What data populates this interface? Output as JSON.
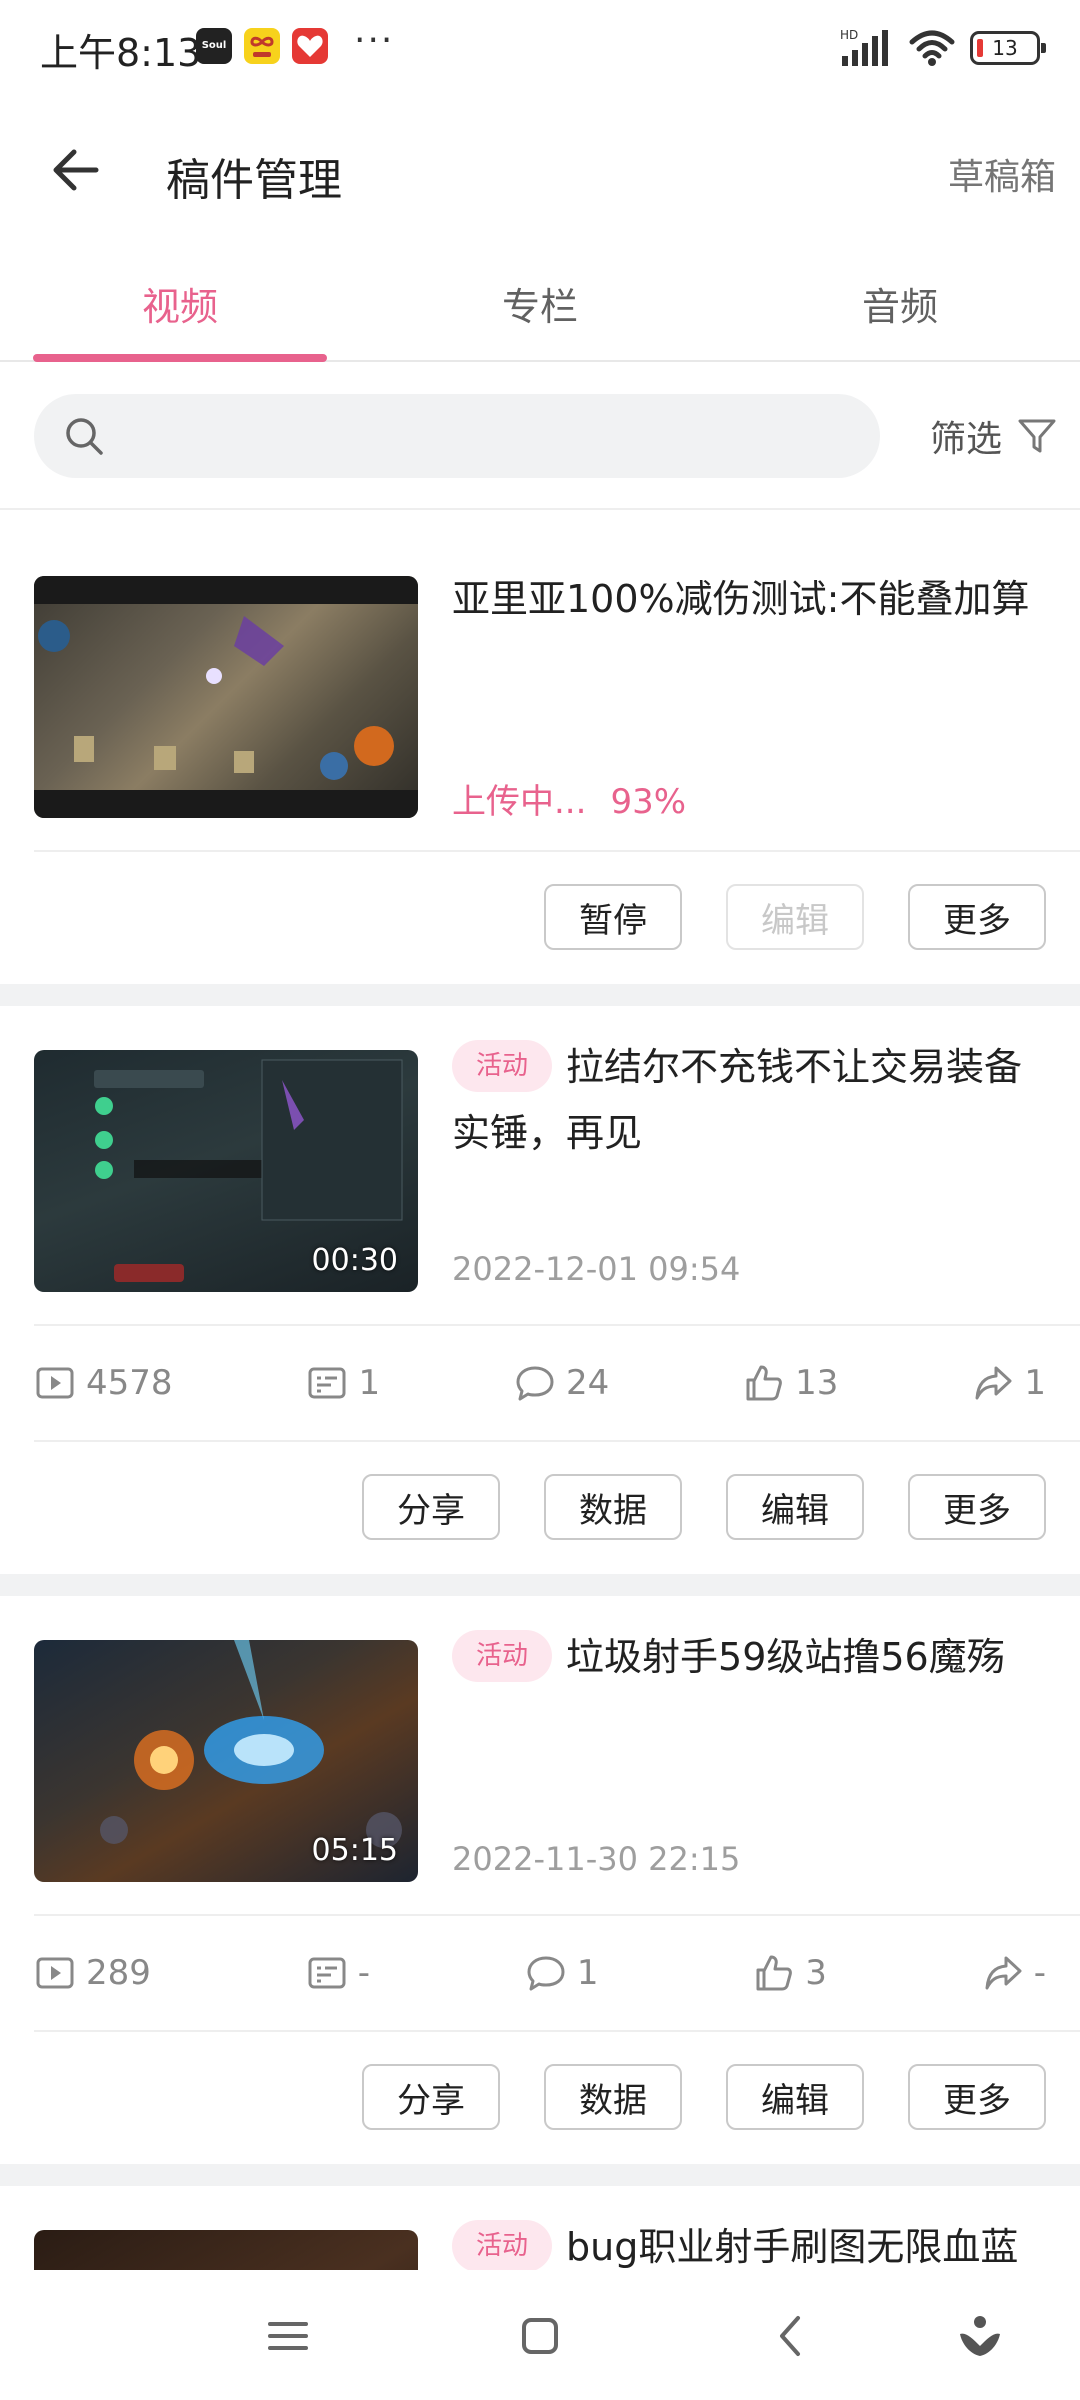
{
  "status_bar": {
    "time": "上午8:13",
    "apps": [
      "Soul",
      "",
      ""
    ],
    "dots": "···",
    "network": "HD",
    "battery": "13"
  },
  "header": {
    "title": "稿件管理",
    "drafts": "草稿箱"
  },
  "tabs": [
    {
      "label": "视频",
      "active": true
    },
    {
      "label": "专栏",
      "active": false
    },
    {
      "label": "音频",
      "active": false
    }
  ],
  "search": {
    "placeholder": "",
    "filter_label": "筛选"
  },
  "videos": [
    {
      "title": "亚里亚100%减伤测试:不能叠加算",
      "upload_status": "上传中...",
      "upload_progress": "93%",
      "actions": [
        "暂停",
        "编辑",
        "更多"
      ]
    },
    {
      "tag": "活动",
      "title": "拉结尔不充钱不让交易装备实锤，再见",
      "duration": "00:30",
      "date": "2022-12-01 09:54",
      "stats": {
        "views": "4578",
        "danmaku": "1",
        "comments": "24",
        "likes": "13",
        "shares": "1"
      },
      "actions": [
        "分享",
        "数据",
        "编辑",
        "更多"
      ]
    },
    {
      "tag": "活动",
      "title": "垃圾射手59级站撸56魔殇",
      "duration": "05:15",
      "date": "2022-11-30 22:15",
      "stats": {
        "views": "289",
        "danmaku": "-",
        "comments": "1",
        "likes": "3",
        "shares": "-"
      },
      "actions": [
        "分享",
        "数据",
        "编辑",
        "更多"
      ]
    },
    {
      "tag": "活动",
      "title": "bug职业射手刷图无限血蓝"
    }
  ],
  "colors": {
    "accent": "#e8628d",
    "tag_bg": "#fde7ee",
    "separator": "#f1f2f3"
  }
}
